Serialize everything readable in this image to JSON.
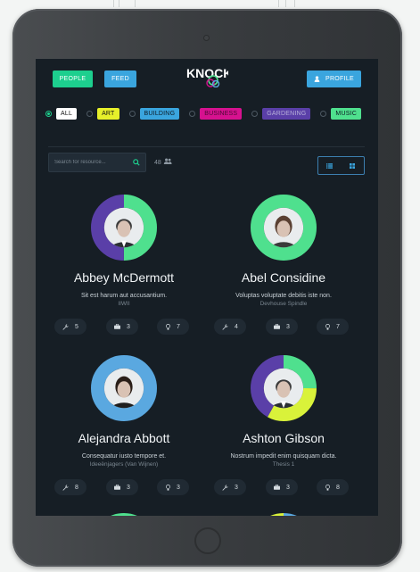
{
  "header": {
    "people_label": "PEOPLE",
    "feed_label": "FEED",
    "logo_text": "KNOCK",
    "profile_label": "PROFILE"
  },
  "filters": [
    {
      "label": "ALL",
      "color": "#ffffff",
      "text_color": "#111111",
      "selected": true
    },
    {
      "label": "ART",
      "color": "#e7f02a",
      "text_color": "#111111",
      "selected": false
    },
    {
      "label": "BUILDING",
      "color": "#3aa5de",
      "text_color": "#0d1a24",
      "selected": false
    },
    {
      "label": "BUSINESS",
      "color": "#d6118f",
      "text_color": "#4a0a33",
      "selected": false
    },
    {
      "label": "GARDENING",
      "color": "#5a3fa8",
      "text_color": "#b7b0d9",
      "selected": false
    },
    {
      "label": "MUSIC",
      "color": "#4fe08e",
      "text_color": "#0d1a24",
      "selected": false
    }
  ],
  "search": {
    "placeholder": "Search for resource...",
    "count": "48"
  },
  "colors": {
    "green": "#4fe08e",
    "purple": "#5a3fa8",
    "blue": "#5aa8e0",
    "yellow": "#d9f23a"
  },
  "people": [
    {
      "name": "Abbey McDermott",
      "description": "Sit est harum aut accusantium.",
      "organization": "IIWII",
      "stats": {
        "tools": "5",
        "bag": "3",
        "ideas": "7"
      },
      "ring": [
        [
          "#4fe08e",
          0.5
        ],
        [
          "#5a3fa8",
          0.5
        ]
      ],
      "photo": "man-suit"
    },
    {
      "name": "Abel Considine",
      "description": "Voluptas voluptate debitis iste non.",
      "organization": "Devhouse Spindle",
      "stats": {
        "tools": "4",
        "bag": "3",
        "ideas": "7"
      },
      "ring": [
        [
          "#4fe08e",
          1.0
        ]
      ],
      "photo": "woman"
    },
    {
      "name": "Alejandra Abbott",
      "description": "Consequatur iusto tempore et.",
      "organization": "Ideeënjagers (Van Wijnen)",
      "stats": {
        "tools": "8",
        "bag": "3",
        "ideas": "3"
      },
      "ring": [
        [
          "#5aa8e0",
          1.0
        ]
      ],
      "photo": "woman-dark"
    },
    {
      "name": "Ashton Gibson",
      "description": "Nostrum impedit enim quisquam dicta.",
      "organization": "Thesis 1",
      "stats": {
        "tools": "3",
        "bag": "3",
        "ideas": "8"
      },
      "ring": [
        [
          "#4fe08e",
          0.25
        ],
        [
          "#d9f23a",
          0.33
        ],
        [
          "#5a3fa8",
          0.42
        ]
      ],
      "photo": "man-suit"
    }
  ],
  "partial_rings": [
    [
      [
        "#4fe08e",
        1.0
      ]
    ],
    [
      [
        "#5aa8e0",
        0.6
      ],
      [
        "#d9f23a",
        0.4
      ]
    ]
  ]
}
